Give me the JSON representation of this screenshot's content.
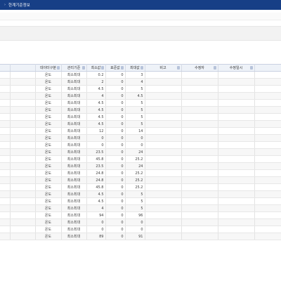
{
  "window": {
    "title": "한계기준정보",
    "bullet": "›"
  },
  "grid": {
    "columns": {
      "data_type": "데이터구분",
      "mgmt_basis": "관리기준",
      "min": "최소값",
      "std": "표준값",
      "max": "최대값",
      "note": "비고",
      "modifier": "수정자",
      "modified_at": "수정일시"
    },
    "rows": [
      {
        "data_type": "온도",
        "mgmt_basis": "최소최대",
        "min": "0.2",
        "std": "0",
        "max": "3"
      },
      {
        "data_type": "온도",
        "mgmt_basis": "최소최대",
        "min": "2",
        "std": "0",
        "max": "4"
      },
      {
        "data_type": "온도",
        "mgmt_basis": "최소최대",
        "min": "4.5",
        "std": "0",
        "max": "5"
      },
      {
        "data_type": "온도",
        "mgmt_basis": "최소최대",
        "min": "4",
        "std": "0",
        "max": "4.5"
      },
      {
        "data_type": "온도",
        "mgmt_basis": "최소최대",
        "min": "4.5",
        "std": "0",
        "max": "5"
      },
      {
        "data_type": "온도",
        "mgmt_basis": "최소최대",
        "min": "4.5",
        "std": "0",
        "max": "5"
      },
      {
        "data_type": "온도",
        "mgmt_basis": "최소최대",
        "min": "4.5",
        "std": "0",
        "max": "5"
      },
      {
        "data_type": "온도",
        "mgmt_basis": "최소최대",
        "min": "4.5",
        "std": "0",
        "max": "5"
      },
      {
        "data_type": "온도",
        "mgmt_basis": "최소최대",
        "min": "12",
        "std": "0",
        "max": "14"
      },
      {
        "data_type": "온도",
        "mgmt_basis": "최소최대",
        "min": "0",
        "std": "0",
        "max": "0"
      },
      {
        "data_type": "온도",
        "mgmt_basis": "최소최대",
        "min": "0",
        "std": "0",
        "max": "0"
      },
      {
        "data_type": "온도",
        "mgmt_basis": "최소최대",
        "min": "23.5",
        "std": "0",
        "max": "24"
      },
      {
        "data_type": "온도",
        "mgmt_basis": "최소최대",
        "min": "45.8",
        "std": "0",
        "max": "25.2"
      },
      {
        "data_type": "온도",
        "mgmt_basis": "최소최대",
        "min": "23.5",
        "std": "0",
        "max": "24"
      },
      {
        "data_type": "온도",
        "mgmt_basis": "최소최대",
        "min": "24.8",
        "std": "0",
        "max": "25.2"
      },
      {
        "data_type": "온도",
        "mgmt_basis": "최소최대",
        "min": "24.8",
        "std": "0",
        "max": "25.2"
      },
      {
        "data_type": "온도",
        "mgmt_basis": "최소최대",
        "min": "45.8",
        "std": "0",
        "max": "25.2"
      },
      {
        "data_type": "온도",
        "mgmt_basis": "최소최대",
        "min": "4.5",
        "std": "0",
        "max": "5"
      },
      {
        "data_type": "온도",
        "mgmt_basis": "최소최대",
        "min": "4.5",
        "std": "0",
        "max": "5"
      },
      {
        "data_type": "온도",
        "mgmt_basis": "최소최대",
        "min": "4",
        "std": "0",
        "max": "5"
      },
      {
        "data_type": "온도",
        "mgmt_basis": "최소최대",
        "min": "94",
        "std": "0",
        "max": "96"
      },
      {
        "data_type": "온도",
        "mgmt_basis": "최소최대",
        "min": "0",
        "std": "0",
        "max": "0"
      },
      {
        "data_type": "온도",
        "mgmt_basis": "최소최대",
        "min": "0",
        "std": "0",
        "max": "0"
      },
      {
        "data_type": "온도",
        "mgmt_basis": "최소최대",
        "min": "89",
        "std": "0",
        "max": "91"
      }
    ]
  },
  "colors": {
    "title_bar": "#173f86",
    "header_bg": "#eef2f8"
  }
}
